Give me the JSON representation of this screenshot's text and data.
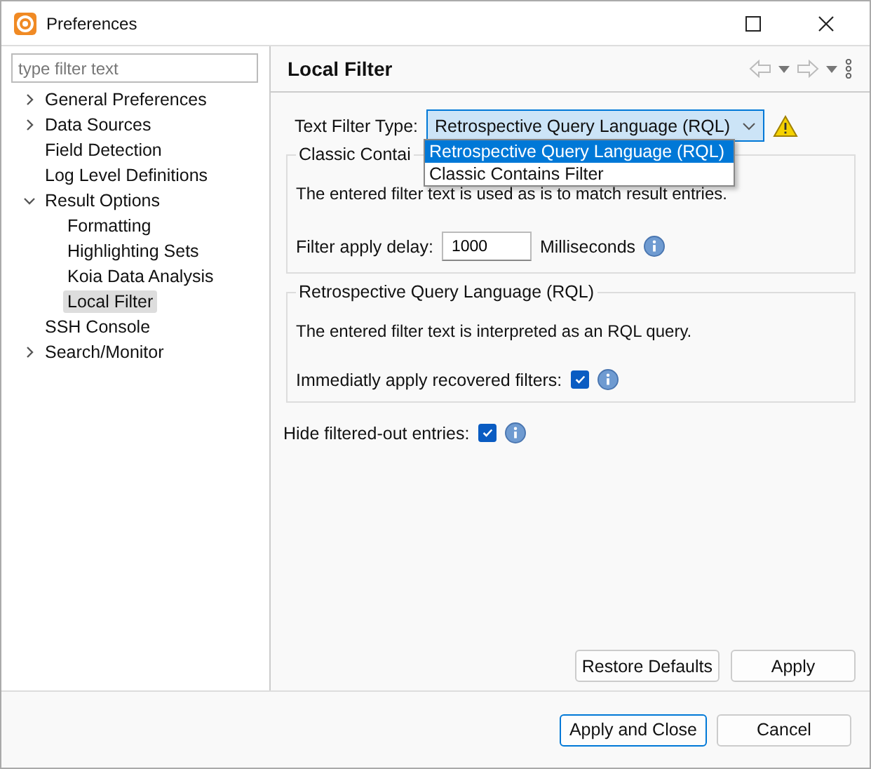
{
  "window": {
    "title": "Preferences"
  },
  "sidebar": {
    "filter_placeholder": "type filter text",
    "items": [
      {
        "label": "General Preferences",
        "expanded": false,
        "selected": false
      },
      {
        "label": "Data Sources",
        "expanded": false,
        "selected": false
      },
      {
        "label": "Field Detection",
        "selected": false
      },
      {
        "label": "Log Level Definitions",
        "selected": false
      },
      {
        "label": "Result Options",
        "expanded": true,
        "selected": false,
        "children": [
          {
            "label": "Formatting",
            "selected": false
          },
          {
            "label": "Highlighting Sets",
            "selected": false
          },
          {
            "label": "Koia Data Analysis",
            "selected": false
          },
          {
            "label": "Local Filter",
            "selected": true
          }
        ]
      },
      {
        "label": "SSH Console",
        "selected": false
      },
      {
        "label": "Search/Monitor",
        "expanded": false,
        "selected": false
      }
    ]
  },
  "page": {
    "title": "Local Filter",
    "filter_type": {
      "label": "Text Filter Type:",
      "value": "Retrospective Query Language (RQL)",
      "warning": true,
      "options": [
        {
          "label": "Retrospective Query Language (RQL)",
          "selected": true
        },
        {
          "label": "Classic Contains Filter",
          "selected": false
        }
      ]
    },
    "classic_group": {
      "legend": "Classic Contai",
      "description": "The entered filter text is used as is to match result entries.",
      "delay_label": "Filter apply delay:",
      "delay_value": "1000",
      "delay_unit": "Milliseconds"
    },
    "rql_group": {
      "legend": "Retrospective Query Language (RQL)",
      "description": "The entered filter text is interpreted as an RQL query.",
      "apply_label": "Immediatly apply recovered filters:",
      "apply_checked": true
    },
    "hide_label": "Hide filtered-out entries:",
    "hide_checked": true,
    "buttons": [
      "Restore Defaults",
      "Apply"
    ]
  },
  "footer_buttons": [
    {
      "label": "Apply and Close",
      "default": true
    },
    {
      "label": "Cancel",
      "default": false
    }
  ]
}
